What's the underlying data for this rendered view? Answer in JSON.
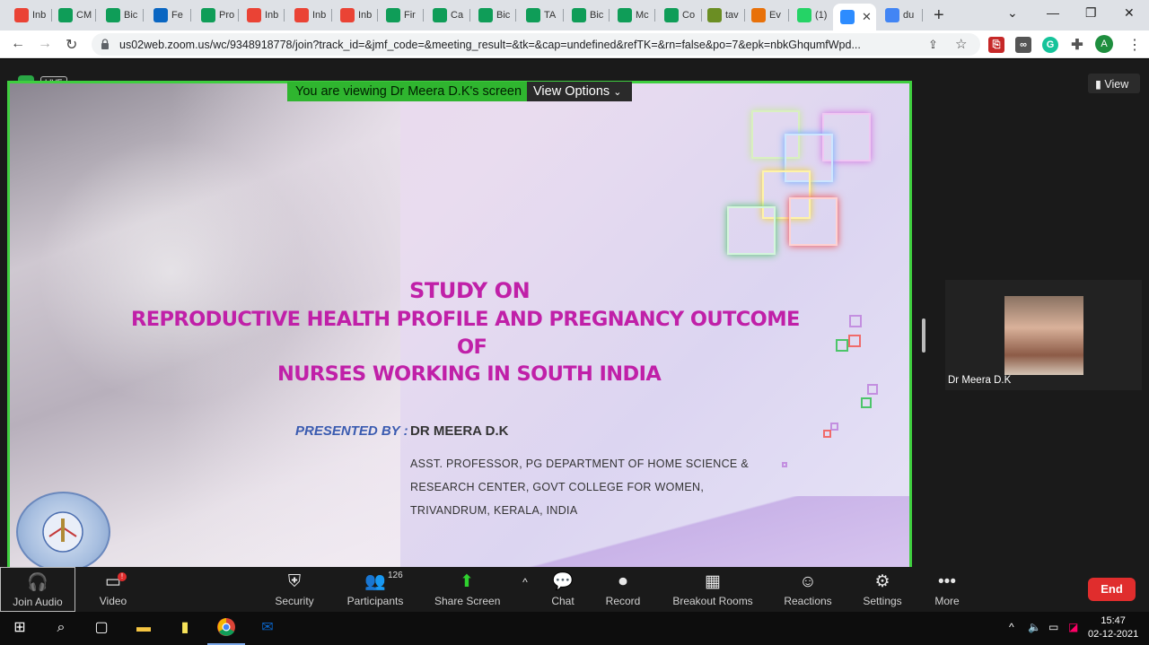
{
  "browser": {
    "tabs": [
      {
        "label": "Inb",
        "icon": "gmail-icon",
        "color": "#ea4335"
      },
      {
        "label": "CM",
        "icon": "sheets-icon",
        "color": "#0f9d58"
      },
      {
        "label": "Bic",
        "icon": "sheets-icon",
        "color": "#0f9d58"
      },
      {
        "label": "Fe",
        "icon": "linkedin-icon",
        "color": "#0a66c2"
      },
      {
        "label": "Pro",
        "icon": "sheets-icon",
        "color": "#0f9d58"
      },
      {
        "label": "Inb",
        "icon": "gmail-icon",
        "color": "#ea4335"
      },
      {
        "label": "Inb",
        "icon": "gmail-icon",
        "color": "#ea4335"
      },
      {
        "label": "Inb",
        "icon": "gmail-icon",
        "color": "#ea4335"
      },
      {
        "label": "Fir",
        "icon": "sheets-icon",
        "color": "#0f9d58"
      },
      {
        "label": "Ca",
        "icon": "sheets-icon",
        "color": "#0f9d58"
      },
      {
        "label": "Bic",
        "icon": "sheets-icon",
        "color": "#0f9d58"
      },
      {
        "label": "TA",
        "icon": "sheets-icon",
        "color": "#0f9d58"
      },
      {
        "label": "Bic",
        "icon": "sheets-icon",
        "color": "#0f9d58"
      },
      {
        "label": "Mc",
        "icon": "sheets-icon",
        "color": "#0f9d58"
      },
      {
        "label": "Co",
        "icon": "sheets-icon",
        "color": "#0f9d58"
      },
      {
        "label": "tav",
        "icon": "leaf-icon",
        "color": "#6b8e23"
      },
      {
        "label": "Ev",
        "icon": "ten-icon",
        "color": "#e8710a"
      },
      {
        "label": "(1)",
        "icon": "whatsapp-icon",
        "color": "#25d366"
      },
      {
        "label": "",
        "icon": "zoom-icon",
        "color": "#2d8cff"
      },
      {
        "label": "du",
        "icon": "google-icon",
        "color": "#4285f4"
      }
    ],
    "url": "us02web.zoom.us/wc/9348918778/join?track_id=&jmf_code=&meeting_result=&tk=&cap=undefined&refTK=&rn=false&po=7&epk=nbkGhqumfWpd...",
    "profile_initial": "A",
    "extension_badge": "0"
  },
  "meeting": {
    "viewing_banner": "You are viewing Dr Meera D.K's screen",
    "view_options": "View Options",
    "live_badge": "LIVE",
    "view_button": "View",
    "participant_name": "Dr Meera D.K"
  },
  "slide": {
    "title_line1": "STUDY ON",
    "title_line2": "REPRODUCTIVE HEALTH PROFILE AND PREGNANCY OUTCOME",
    "title_line3": "OF",
    "title_line4": "NURSES WORKING IN SOUTH INDIA",
    "presented_by_label": "PRESENTED BY :",
    "presenter": "DR MEERA D.K",
    "affiliation_line1": "ASST. PROFESSOR, PG DEPARTMENT OF HOME SCIENCE &",
    "affiliation_line2": "RESEARCH CENTER, GOVT COLLEGE FOR WOMEN,",
    "affiliation_line3": "TRIVANDRUM, KERALA, INDIA",
    "logo_text": "FOR THE HOME AND THE COUNTRY"
  },
  "toolbar": {
    "join_audio": "Join Audio",
    "video": "Video",
    "security": "Security",
    "participants": "Participants",
    "participants_count": "126",
    "share_screen": "Share Screen",
    "chat": "Chat",
    "record": "Record",
    "breakout_rooms": "Breakout Rooms",
    "reactions": "Reactions",
    "settings": "Settings",
    "more": "More",
    "end": "End"
  },
  "taskbar": {
    "time": "15:47",
    "date": "02-12-2021"
  }
}
